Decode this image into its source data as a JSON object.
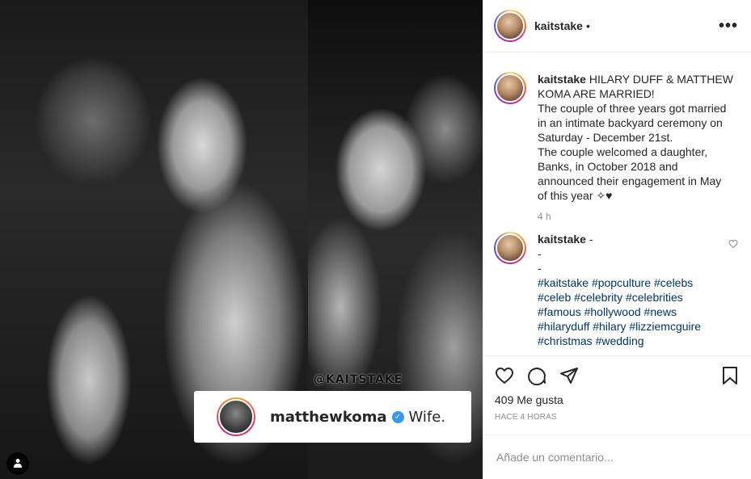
{
  "photo": {
    "watermark": "@KAITSTAKE",
    "card": {
      "username": "matthewkoma",
      "verified_icon": "verified-badge-icon",
      "text": "Wife."
    },
    "user_tag_icon": "user-icon"
  },
  "header": {
    "username": "kaitstake",
    "separator": "•",
    "more_label": "•••"
  },
  "caption": {
    "username": "kaitstake",
    "lines": [
      "HILARY DUFF & MATTHEW",
      "KOMA ARE MARRIED!",
      "The couple of three years got married",
      "in an intimate backyard ceremony on",
      "Saturday - December 21st.",
      "The couple welcomed a daughter,",
      "Banks, in October 2018 and",
      "announced their engagement in May",
      "of this year ✧♥"
    ],
    "time": "4 h"
  },
  "comment": {
    "username": "kaitstake",
    "first_line_suffix": " -",
    "dash_lines": [
      "-",
      "-"
    ],
    "hashtag_lines": [
      [
        "#kaitstake",
        "#popculture",
        "#celebs"
      ],
      [
        "#celeb",
        "#celebrity",
        "#celebrities"
      ],
      [
        "#famous",
        "#hollywood",
        "#news"
      ],
      [
        "#hilaryduff",
        "#hilary",
        "#lizziemcguire"
      ],
      [
        "#christmas",
        "#wedding"
      ]
    ]
  },
  "actions": {
    "likes": "409 Me gusta",
    "time_ago": "HACE 4 HORAS"
  },
  "add_comment": {
    "placeholder": "Añade un comentario..."
  }
}
